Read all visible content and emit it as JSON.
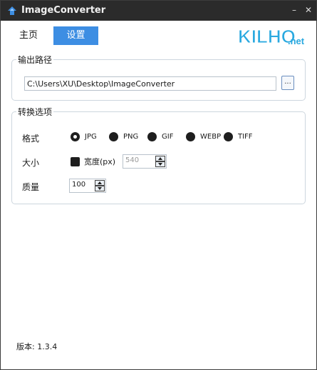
{
  "window": {
    "title": "ImageConverter",
    "minimize_label": "–",
    "close_label": "✕"
  },
  "nav": {
    "tabs": [
      {
        "label": "主页",
        "active": false
      },
      {
        "label": "设置",
        "active": true
      }
    ]
  },
  "logo": {
    "text": "KILHO",
    "suffix": ".net",
    "color": "#2aa9e0"
  },
  "output": {
    "legend": "输出路径",
    "path": "C:\\Users\\XU\\Desktop\\ImageConverter",
    "browse_label": "..."
  },
  "options": {
    "legend": "转换选项",
    "format_label": "格式",
    "formats": [
      {
        "label": "JPG",
        "checked": true
      },
      {
        "label": "PNG",
        "checked": false
      },
      {
        "label": "GIF",
        "checked": false
      },
      {
        "label": "WEBP",
        "checked": false
      },
      {
        "label": "TIFF",
        "checked": false
      }
    ],
    "size_label": "大小",
    "width_checkbox_label": "宽度(px)",
    "width_checked": true,
    "width_value": "540",
    "quality_label": "质量",
    "quality_value": "100"
  },
  "footer": {
    "version": "版本: 1.3.4"
  },
  "colors": {
    "titlebar": "#2b2b2b",
    "accent": "#3d8ee3",
    "group_border": "#cdd6de"
  }
}
